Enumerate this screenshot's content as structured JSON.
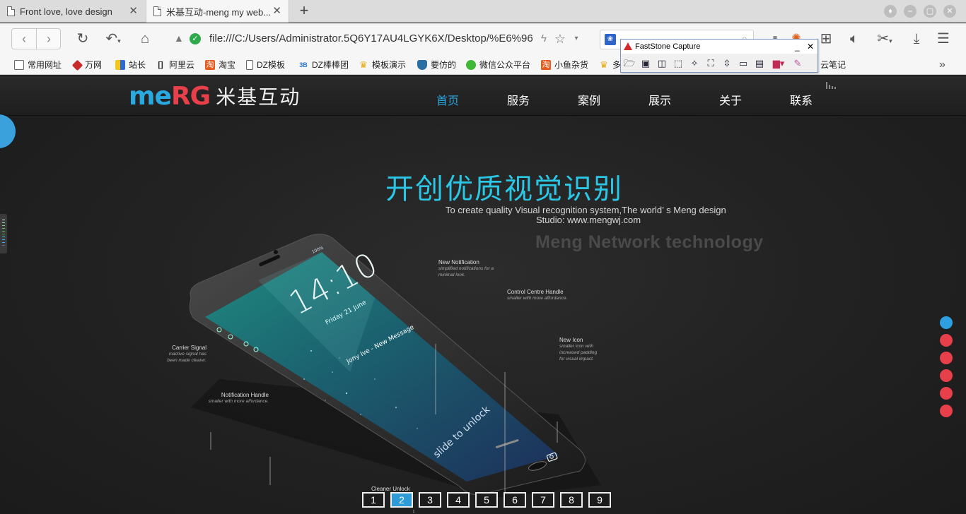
{
  "browser": {
    "tabs": [
      {
        "title": "Front love, love design",
        "active": false
      },
      {
        "title": "米基互动-meng my web...",
        "active": true
      }
    ],
    "new_tab": "+",
    "url": "file:///C:/Users/Administrator.5Q6Y17AU4LGYK6X/Desktop/%E6%96",
    "bookmarks": [
      {
        "label": "常用网址",
        "icon": "folder-icon"
      },
      {
        "label": "万网",
        "icon": "wanwang-icon"
      },
      {
        "label": "站长",
        "icon": "zhanzhang-icon"
      },
      {
        "label": "阿里云",
        "icon": "aliyun-icon"
      },
      {
        "label": "淘宝",
        "icon": "taobao-icon"
      },
      {
        "label": "DZ模板",
        "icon": "page-icon"
      },
      {
        "label": "DZ棒棒团",
        "icon": "dz-icon"
      },
      {
        "label": "模板演示",
        "icon": "trophy-icon"
      },
      {
        "label": "要仿的",
        "icon": "shield-icon"
      },
      {
        "label": "微信公众平台",
        "icon": "wechat-icon"
      },
      {
        "label": "小鱼杂货",
        "icon": "taobao-icon"
      },
      {
        "label": "多",
        "icon": "trophy-icon"
      },
      {
        "label": "云笔记",
        "icon": "note-icon"
      }
    ],
    "more": "»"
  },
  "faststone": {
    "title": "FastStone Capture",
    "minimize": "_",
    "close": "✕"
  },
  "site": {
    "logo_en_1": "me",
    "logo_en_2": "RG",
    "logo_cn": "米基互动",
    "nav": [
      {
        "label": "首页",
        "active": true
      },
      {
        "label": "服务",
        "active": false
      },
      {
        "label": "案例",
        "active": false
      },
      {
        "label": "展示",
        "active": false
      },
      {
        "label": "关于",
        "active": false
      },
      {
        "label": "联系",
        "active": false
      }
    ]
  },
  "hero": {
    "title": "开创优质视觉识别",
    "subtitle_1": "To create quality Visual recognition system,The world’ s Meng design",
    "subtitle_2": "Studio: www.mengwj.com",
    "tagline": "Meng Network technology"
  },
  "phone": {
    "time": "14:10",
    "date": "Friday 21 June",
    "message": "Jony Ive - New Message",
    "slide": "slide to unlock",
    "status": "100%"
  },
  "annotations": [
    {
      "title": "New Notification",
      "desc": "simplified notifications for a minimal look."
    },
    {
      "title": "Control Centre Handle",
      "desc": "smaller with more affordance."
    },
    {
      "title": "New Icon",
      "desc": "smaller icon with increased padding for visual impact."
    },
    {
      "title": "Carrier Signal",
      "desc": "inactive signal has been made clearer."
    },
    {
      "title": "Notification Handle",
      "desc": "smaller with more affordance."
    },
    {
      "title": "Cleaner Unlock",
      "desc": ""
    }
  ],
  "slider_dots": {
    "count": 6,
    "active_index": 0,
    "active_color": "#2e9fe0",
    "inactive_color": "#e8404a"
  },
  "pagination": {
    "pages": [
      "1",
      "2",
      "3",
      "4",
      "5",
      "6",
      "7",
      "8",
      "9"
    ],
    "active": "2"
  }
}
